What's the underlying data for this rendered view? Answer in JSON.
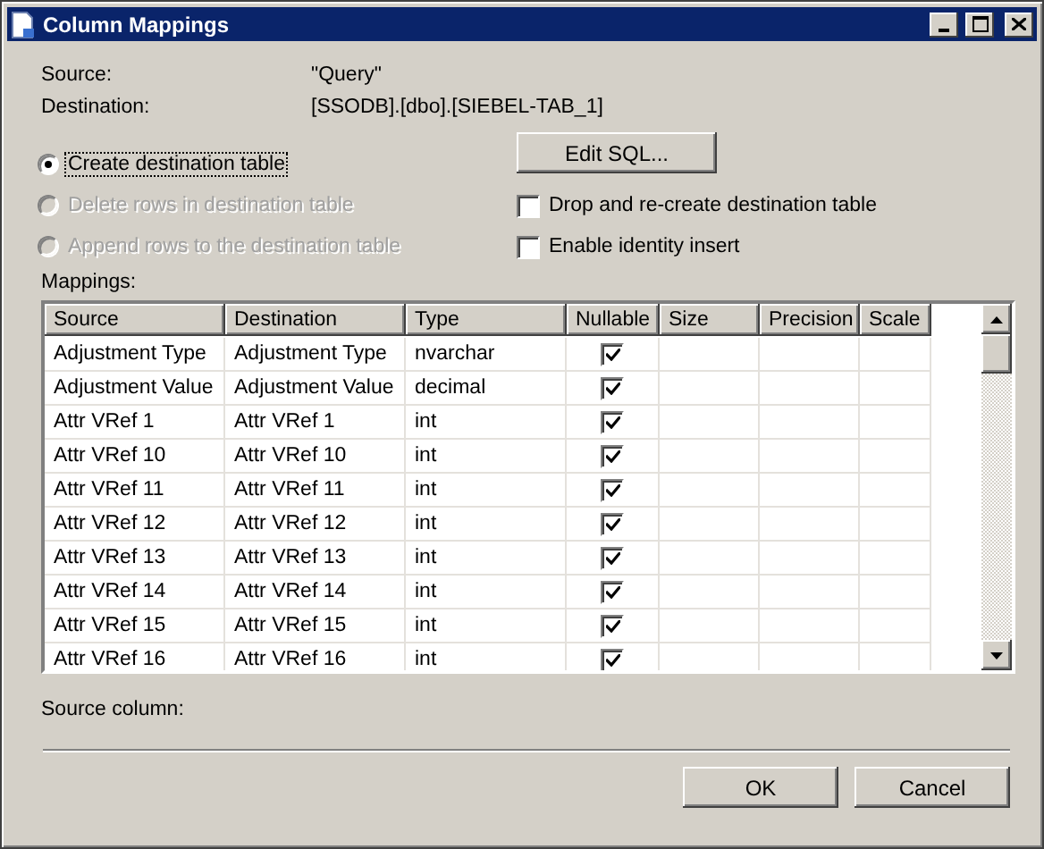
{
  "window": {
    "title": "Column Mappings"
  },
  "info": [
    {
      "label": "Source:",
      "value": "\"Query\""
    },
    {
      "label": "Destination:",
      "value": "[SSODB].[dbo].[SIEBEL-TAB_1]"
    }
  ],
  "options": [
    {
      "label": "Create destination table",
      "selected": true,
      "disabled": false
    },
    {
      "label": "Delete rows in destination table",
      "selected": false,
      "disabled": true
    },
    {
      "label": "Append rows to the destination table",
      "selected": false,
      "disabled": true
    }
  ],
  "edit_sql_button": "Edit SQL...",
  "checkboxes": [
    {
      "label": "Drop and re-create destination table",
      "checked": false
    },
    {
      "label": "Enable identity insert",
      "checked": false
    }
  ],
  "mappings": {
    "label": "Mappings:",
    "columns": [
      "Source",
      "Destination",
      "Type",
      "Nullable",
      "Size",
      "Precision",
      "Scale"
    ],
    "rows": [
      {
        "source": "Adjustment Type",
        "destination": "Adjustment Type",
        "type": "nvarchar",
        "nullable": true
      },
      {
        "source": "Adjustment Value",
        "destination": "Adjustment Value",
        "type": "decimal",
        "nullable": true
      },
      {
        "source": "Attr VRef 1",
        "destination": "Attr VRef 1",
        "type": "int",
        "nullable": true
      },
      {
        "source": "Attr VRef 10",
        "destination": "Attr VRef 10",
        "type": "int",
        "nullable": true
      },
      {
        "source": "Attr VRef 11",
        "destination": "Attr VRef 11",
        "type": "int",
        "nullable": true
      },
      {
        "source": "Attr VRef 12",
        "destination": "Attr VRef 12",
        "type": "int",
        "nullable": true
      },
      {
        "source": "Attr VRef 13",
        "destination": "Attr VRef 13",
        "type": "int",
        "nullable": true
      },
      {
        "source": "Attr VRef 14",
        "destination": "Attr VRef 14",
        "type": "int",
        "nullable": true
      },
      {
        "source": "Attr VRef 15",
        "destination": "Attr VRef 15",
        "type": "int",
        "nullable": true
      },
      {
        "source": "Attr VRef 16",
        "destination": "Attr VRef 16",
        "type": "int",
        "nullable": true
      }
    ]
  },
  "source_column_label": "Source column:",
  "buttons": [
    "OK",
    "Cancel"
  ]
}
